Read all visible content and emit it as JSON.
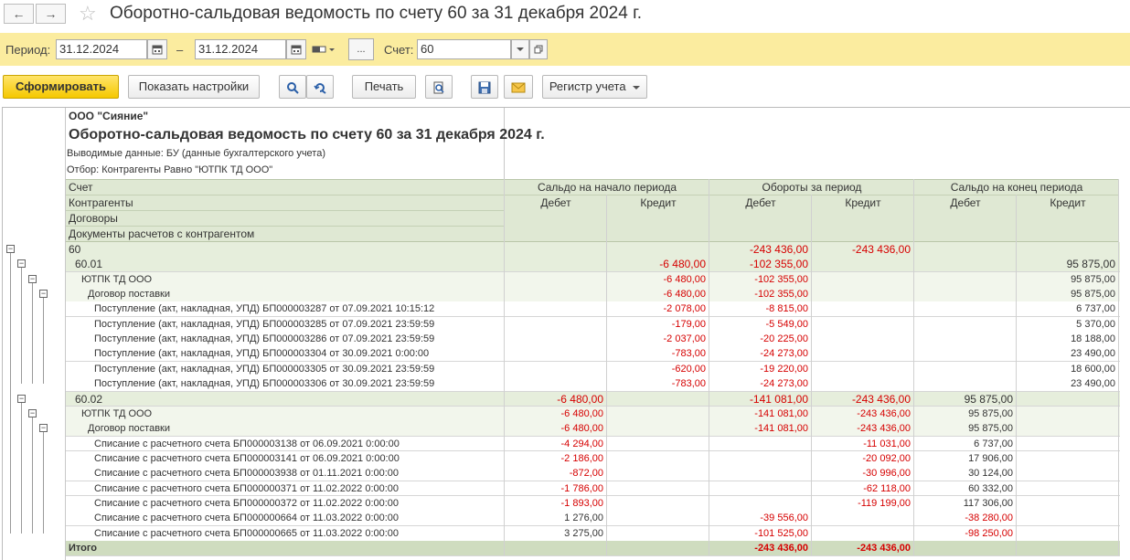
{
  "window": {
    "title": "Оборотно-сальдовая ведомость по счету 60 за 31 декабря 2024 г.",
    "back_glyph": "←",
    "forward_glyph": "→",
    "star_glyph": "☆"
  },
  "filter": {
    "period_label": "Период:",
    "date_from": "31.12.2024",
    "dash": "–",
    "date_to": "31.12.2024",
    "more_label": "...",
    "account_label": "Счет:",
    "account_value": "60"
  },
  "toolbar": {
    "generate_label": "Сформировать",
    "show_settings_label": "Показать настройки",
    "print_label": "Печать",
    "register_label": "Регистр учета"
  },
  "report": {
    "org": "ООО \"Сияние\"",
    "heading": "Оборотно-сальдовая ведомость по счету 60 за 31 декабря 2024 г.",
    "output_data": "Выводимые данные: БУ (данные бухгалтерского учета)",
    "selection": "Отбор: Контрагенты Равно \"ЮТПК ТД  ООО\"",
    "row_headers": [
      "Счет",
      "Контрагенты",
      "Договоры",
      "Документы расчетов с контрагентом"
    ],
    "group_headers": [
      "Сальдо на начало периода",
      "Обороты за период",
      "Сальдо на конец периода"
    ],
    "sub_headers": [
      "Дебет",
      "Кредит",
      "Дебет",
      "Кредит",
      "Дебет",
      "Кредит"
    ],
    "rows": [
      {
        "label": "60",
        "indent": 0,
        "level": 0,
        "v": [
          "",
          "",
          "-243 436,00",
          "-243 436,00",
          "",
          ""
        ],
        "red": [
          false,
          false,
          true,
          true,
          false,
          false
        ]
      },
      {
        "label": "60.01",
        "indent": 1,
        "level": 0,
        "v": [
          "",
          "-6 480,00",
          "-102 355,00",
          "",
          "",
          "95 875,00"
        ],
        "red": [
          false,
          true,
          true,
          false,
          false,
          false
        ]
      },
      {
        "label": "ЮТПК ТД  ООО",
        "indent": 2,
        "level": 1,
        "v": [
          "",
          "-6 480,00",
          "-102 355,00",
          "",
          "",
          "95 875,00"
        ],
        "red": [
          false,
          true,
          true,
          false,
          false,
          false
        ]
      },
      {
        "label": "Договор поставки",
        "indent": 3,
        "level": 1,
        "v": [
          "",
          "-6 480,00",
          "-102 355,00",
          "",
          "",
          "95 875,00"
        ],
        "red": [
          false,
          true,
          true,
          false,
          false,
          false
        ]
      },
      {
        "label": "Поступление (акт, накладная, УПД) БП000003287 от 07.09.2021 10:15:12",
        "indent": 4,
        "level": 2,
        "v": [
          "",
          "-2 078,00",
          "-8 815,00",
          "",
          "",
          "6 737,00"
        ],
        "red": [
          false,
          true,
          true,
          false,
          false,
          false
        ]
      },
      {
        "label": "Поступление (акт, накладная, УПД) БП000003285 от 07.09.2021 23:59:59",
        "indent": 4,
        "level": 2,
        "v": [
          "",
          "-179,00",
          "-5 549,00",
          "",
          "",
          "5 370,00"
        ],
        "red": [
          false,
          true,
          true,
          false,
          false,
          false
        ]
      },
      {
        "label": "Поступление (акт, накладная, УПД) БП000003286 от 07.09.2021 23:59:59",
        "indent": 4,
        "level": 2,
        "v": [
          "",
          "-2 037,00",
          "-20 225,00",
          "",
          "",
          "18 188,00"
        ],
        "red": [
          false,
          true,
          true,
          false,
          false,
          false
        ]
      },
      {
        "label": "Поступление (акт, накладная, УПД) БП000003304 от 30.09.2021 0:00:00",
        "indent": 4,
        "level": 2,
        "v": [
          "",
          "-783,00",
          "-24 273,00",
          "",
          "",
          "23 490,00"
        ],
        "red": [
          false,
          true,
          true,
          false,
          false,
          false
        ]
      },
      {
        "label": "Поступление (акт, накладная, УПД) БП000003305 от 30.09.2021 23:59:59",
        "indent": 4,
        "level": 2,
        "v": [
          "",
          "-620,00",
          "-19 220,00",
          "",
          "",
          "18 600,00"
        ],
        "red": [
          false,
          true,
          true,
          false,
          false,
          false
        ]
      },
      {
        "label": "Поступление (акт, накладная, УПД) БП000003306 от 30.09.2021 23:59:59",
        "indent": 4,
        "level": 2,
        "v": [
          "",
          "-783,00",
          "-24 273,00",
          "",
          "",
          "23 490,00"
        ],
        "red": [
          false,
          true,
          true,
          false,
          false,
          false
        ]
      },
      {
        "label": "60.02",
        "indent": 1,
        "level": 0,
        "v": [
          "-6 480,00",
          "",
          "-141 081,00",
          "-243 436,00",
          "95 875,00",
          ""
        ],
        "red": [
          true,
          false,
          true,
          true,
          false,
          false
        ]
      },
      {
        "label": "ЮТПК ТД  ООО",
        "indent": 2,
        "level": 1,
        "v": [
          "-6 480,00",
          "",
          "-141 081,00",
          "-243 436,00",
          "95 875,00",
          ""
        ],
        "red": [
          true,
          false,
          true,
          true,
          false,
          false
        ]
      },
      {
        "label": "Договор поставки",
        "indent": 3,
        "level": 1,
        "v": [
          "-6 480,00",
          "",
          "-141 081,00",
          "-243 436,00",
          "95 875,00",
          ""
        ],
        "red": [
          true,
          false,
          true,
          true,
          false,
          false
        ]
      },
      {
        "label": "Списание с расчетного счета БП000003138 от 06.09.2021 0:00:00",
        "indent": 4,
        "level": 2,
        "v": [
          "-4 294,00",
          "",
          "",
          "-11 031,00",
          "6 737,00",
          ""
        ],
        "red": [
          true,
          false,
          false,
          true,
          false,
          false
        ]
      },
      {
        "label": "Списание с расчетного счета БП000003141 от 06.09.2021 0:00:00",
        "indent": 4,
        "level": 2,
        "v": [
          "-2 186,00",
          "",
          "",
          "-20 092,00",
          "17 906,00",
          ""
        ],
        "red": [
          true,
          false,
          false,
          true,
          false,
          false
        ]
      },
      {
        "label": "Списание с расчетного счета БП000003938 от 01.11.2021 0:00:00",
        "indent": 4,
        "level": 2,
        "v": [
          "-872,00",
          "",
          "",
          "-30 996,00",
          "30 124,00",
          ""
        ],
        "red": [
          true,
          false,
          false,
          true,
          false,
          false
        ]
      },
      {
        "label": "Списание с расчетного счета БП000000371 от 11.02.2022 0:00:00",
        "indent": 4,
        "level": 2,
        "v": [
          "-1 786,00",
          "",
          "",
          "-62 118,00",
          "60 332,00",
          ""
        ],
        "red": [
          true,
          false,
          false,
          true,
          false,
          false
        ]
      },
      {
        "label": "Списание с расчетного счета БП000000372 от 11.02.2022 0:00:00",
        "indent": 4,
        "level": 2,
        "v": [
          "-1 893,00",
          "",
          "",
          "-119 199,00",
          "117 306,00",
          ""
        ],
        "red": [
          true,
          false,
          false,
          true,
          false,
          false
        ]
      },
      {
        "label": "Списание с расчетного счета БП000000664 от 11.03.2022 0:00:00",
        "indent": 4,
        "level": 2,
        "v": [
          "1 276,00",
          "",
          "-39 556,00",
          "",
          "-38 280,00",
          ""
        ],
        "red": [
          false,
          false,
          true,
          false,
          true,
          false
        ]
      },
      {
        "label": "Списание с расчетного счета БП000000665 от 11.03.2022 0:00:00",
        "indent": 4,
        "level": 2,
        "v": [
          "3 275,00",
          "",
          "-101 525,00",
          "",
          "-98 250,00",
          ""
        ],
        "red": [
          false,
          false,
          true,
          false,
          true,
          false
        ]
      }
    ],
    "total": {
      "label": "Итого",
      "v": [
        "",
        "",
        "-243 436,00",
        "-243 436,00",
        "",
        ""
      ],
      "red": [
        false,
        false,
        true,
        true,
        false,
        false
      ]
    }
  },
  "colors": {
    "accent_yellow": "#f5c800",
    "filter_bg": "#fbec9f",
    "header_green": "#dfe8d3",
    "group_row_green": "#e6eedc",
    "subgroup_row_green": "#f2f6ec",
    "negative_red": "#d60000",
    "total_green": "#cfdcbf"
  }
}
